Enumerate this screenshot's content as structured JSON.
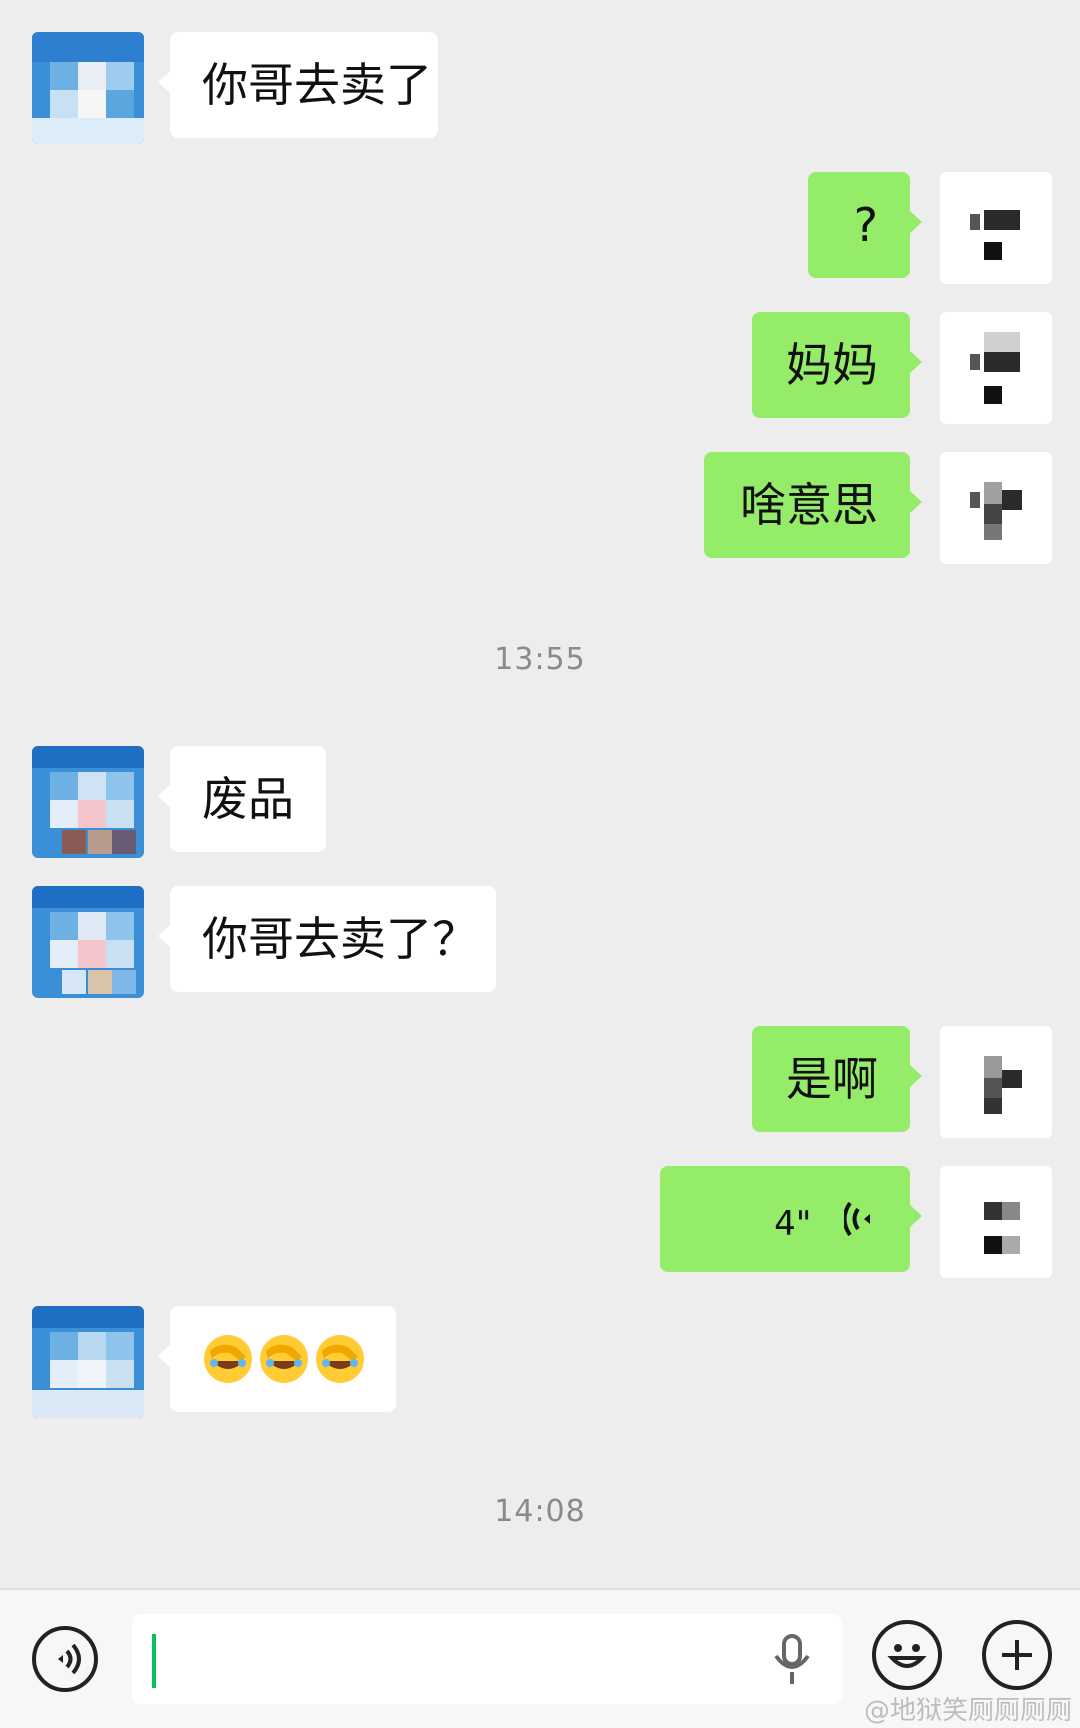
{
  "messages": {
    "m1": {
      "text": "你哥去卖了"
    },
    "m2": {
      "text": "?"
    },
    "m3": {
      "text": "妈妈"
    },
    "m4": {
      "text": "啥意思"
    },
    "m5": {
      "text": "废品"
    },
    "m6": {
      "text": "你哥去卖了？"
    },
    "m7": {
      "text": "是啊"
    },
    "m8": {
      "duration": "4\""
    },
    "m9": {
      "emoji": "face-palm-crying-emoji"
    }
  },
  "timestamps": {
    "t1": "13:55",
    "t2": "14:08"
  },
  "input_bar": {
    "value": "",
    "watermark": "@地狱笑厕厕厕厕"
  },
  "colors": {
    "background": "#ededed",
    "outgoing_bubble": "#95ec69",
    "incoming_bubble": "#ffffff",
    "caret": "#07c160"
  }
}
